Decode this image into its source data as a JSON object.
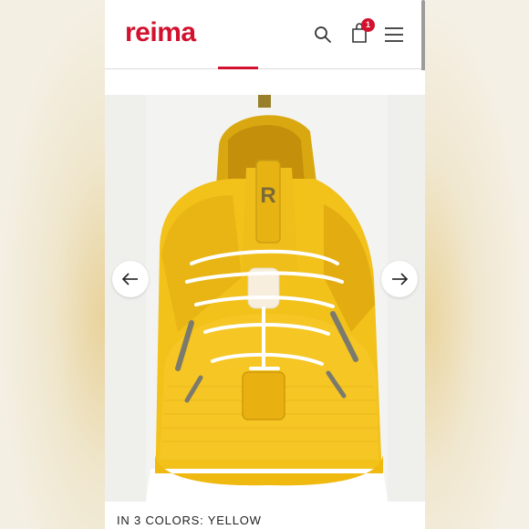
{
  "brand": {
    "logo_text": "reima",
    "color": "#d2112e"
  },
  "header": {
    "icons": [
      "search-icon",
      "shopping-bag-icon",
      "hamburger-menu-icon"
    ],
    "cart_count": "1"
  },
  "gallery": {
    "product_color": "#f2c11a",
    "prev_icon": "arrow-left-icon",
    "next_icon": "arrow-right-icon"
  },
  "product": {
    "colors_label": "IN 3 COLORS: YELLOW"
  }
}
